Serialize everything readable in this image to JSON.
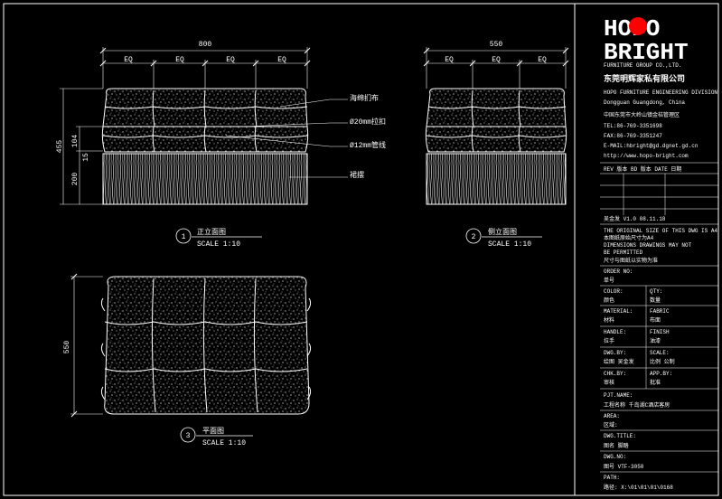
{
  "colors": {
    "background": "#000000",
    "line": "#ffffff",
    "dim": "#ffff66",
    "logo_red": "#ff0000"
  },
  "front_view": {
    "width": "800",
    "eq": [
      "EQ",
      "EQ",
      "EQ",
      "EQ"
    ],
    "height": "455",
    "cushion_h": "104",
    "gap_h": "15",
    "base_h": "200",
    "callouts": [
      "海绵扪布",
      "Ø20mm拉扣",
      "Ø12mm管线",
      "裙摆"
    ],
    "number": "1",
    "title": "正立面图",
    "scale": "SCALE 1:10"
  },
  "side_view": {
    "width": "550",
    "eq": [
      "EQ",
      "EQ",
      "EQ"
    ],
    "number": "2",
    "title": "侧立面图",
    "scale": "SCALE 1:10"
  },
  "plan_view": {
    "height": "550",
    "number": "3",
    "title": "平面图",
    "scale": "SCALE 1:10"
  },
  "title_block": {
    "logo_top": "HOPO",
    "logo_bottom": "BRIGHT",
    "company_en": "FURNITURE GROUP CO.,LTD.",
    "company_cn": "东莞明辉家私有限公司",
    "info": [
      "HOPO FURNITURE ENGINEERING DIVISION",
      "Dongguan Guangdong, China",
      "中国东莞市大岭山镇金桔管理区",
      "TEL:86-769-3351698",
      "FAX:86-769-3351247",
      "E-MAIL:hbright@gd.dgnet.gd.cn",
      "http://www.hopo-bright.com"
    ],
    "rev_header": "REV 版本   BD 版本   DATE 日期",
    "rev_row": "吴金发    V1.0    08.11.18",
    "note": [
      "THE ORIGINAL SIZE OF THIS DWG IS A4",
      "本图纸原始尺寸为A4",
      "DIMENSIONS DRAWINGS MAY NOT",
      "BE PERMITTED",
      "尺寸与图纸以实物为准"
    ],
    "order_no": "ORDER NO:",
    "order_label": "单号",
    "fields": [
      {
        "l1": "COLOR:",
        "l2": "颜色",
        "r1": "QTY:",
        "r2": "数量"
      },
      {
        "l1": "MATERIAL:",
        "l2": "材料",
        "r1": "FABRIC",
        "r2": "布面"
      },
      {
        "l1": "HANDLE:",
        "l2": "拉手",
        "r1": "FINISH",
        "r2": "油漆"
      },
      {
        "l1": "DWG.BY:",
        "l2": "绘图   吴金发",
        "r1": "SCALE:",
        "r2": "比例  公制"
      },
      {
        "l1": "CHK.BY:",
        "l2": "审核",
        "r1": "APP.BY:",
        "r2": "批准"
      }
    ],
    "prj_label": "PJT.NAME:",
    "prj_value": "工程名称      千岛湖C酒店客房",
    "area_label": "AREA:",
    "area_value": "区域:",
    "dwg_title_label": "DWG.TITLE:",
    "dwg_title_value": "图名         脚踏",
    "dwg_no_label": "DWG.NO:",
    "dwg_no_value": "图号         VTF-3050",
    "path_label": "PATH:",
    "path_value": "路径:   X:\\01\\01\\01\\0168"
  }
}
